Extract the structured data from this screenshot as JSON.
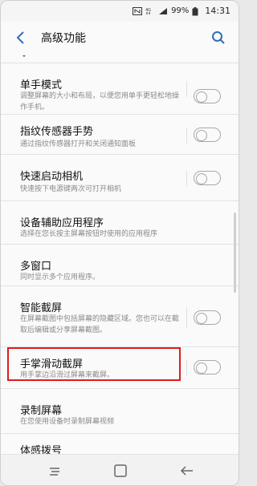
{
  "status_bar": {
    "battery_pct": "99%",
    "time": "14:31",
    "icons": [
      "nfc-icon",
      "4g-icon",
      "signal-icon",
      "battery-icon"
    ]
  },
  "app_bar": {
    "title": "高级功能",
    "icons": [
      "back-arrow-icon",
      "search-icon"
    ]
  },
  "settings": [
    {
      "title": "单手模式",
      "subtitle": "调整屏幕的大小和布局，以便您用单手更轻松地操作手机。",
      "toggle": false
    },
    {
      "title": "指纹传感器手势",
      "subtitle": "通过指纹传感器打开和关闭通知面板",
      "toggle": false
    },
    {
      "title": "快速启动相机",
      "subtitle": "快速按下电源键两次可打开相机",
      "toggle": false
    },
    {
      "title": "设备辅助应用程序",
      "subtitle": "选择在您长按主屏幕按钮时使用的应用程序"
    },
    {
      "title": "多窗口",
      "subtitle": "同时显示多个应用程序。"
    },
    {
      "title": "智能截屏",
      "subtitle": "在屏幕截图中包括屏幕的隐藏区域。您也可以在截取后编辑或分享屏幕截图。",
      "toggle": false
    },
    {
      "title": "手掌滑动截屏",
      "subtitle": "用手掌边沿滑过屏幕来截屏。",
      "toggle": false
    },
    {
      "title": "录制屏幕",
      "subtitle": "在您使用设备时录制屏幕视频"
    },
    {
      "title": "体感拨号",
      "subtitle": ""
    }
  ],
  "nav_bar": {
    "icons": [
      "recent-apps-icon",
      "home-icon",
      "back-icon"
    ]
  }
}
